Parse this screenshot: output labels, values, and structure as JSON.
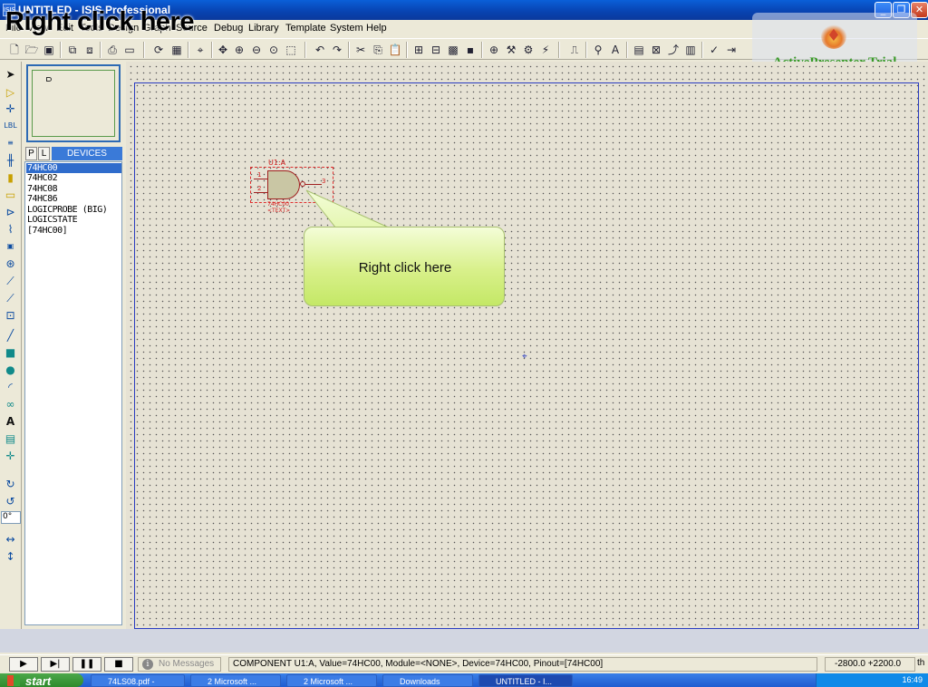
{
  "window": {
    "app_icon": "ISIS",
    "title": "UNTITLED - ISIS Professional",
    "minimize": "_",
    "maximize": "❐",
    "close": "✕"
  },
  "overlay": {
    "heading": "Right click here"
  },
  "menu": {
    "items": [
      "File",
      "View",
      "Edit",
      "Tools",
      "Design",
      "Graph",
      "Source",
      "Debug",
      "Library",
      "Template",
      "System",
      "Help"
    ]
  },
  "toolbar": {
    "icons": [
      "new-file-icon",
      "open-file-icon",
      "save-icon",
      "import-icon",
      "export-icon",
      "print-icon",
      "mark-area-icon",
      "redraw-icon",
      "grid-icon",
      "origin-icon",
      "pan-icon",
      "zoom-in-icon",
      "zoom-out-icon",
      "zoom-all-icon",
      "zoom-area-icon",
      "undo-icon",
      "redo-icon",
      "cut-icon",
      "copy-icon",
      "paste-icon",
      "block-copy-icon",
      "block-move-icon",
      "block-rotate-icon",
      "block-delete-icon",
      "pick-device-icon",
      "make-device-icon",
      "packaging-tool-icon",
      "decompose-icon",
      "wire-autorouter-icon",
      "search-tag-icon",
      "property-tool-icon",
      "new-sheet-icon",
      "remove-sheet-icon",
      "exit-to-parent-icon",
      "view-bom-icon",
      "electrical-rules-check-icon",
      "netlist-to-ares-icon"
    ]
  },
  "watermark": {
    "text": "ActivePresenter Trial"
  },
  "tools": {
    "angle": "0°"
  },
  "devices": {
    "tab_p": "P",
    "tab_l": "L",
    "header": "DEVICES",
    "items": [
      {
        "name": "74HC00",
        "selected": true
      },
      {
        "name": "74HC02",
        "selected": false
      },
      {
        "name": "74HC08",
        "selected": false
      },
      {
        "name": "74HC86",
        "selected": false
      },
      {
        "name": "LOGICPROBE (BIG)",
        "selected": false
      },
      {
        "name": "LOGICSTATE",
        "selected": false
      },
      {
        "name": "[74HC00]",
        "selected": false
      }
    ]
  },
  "component": {
    "ref": "U1:A",
    "pin1": "1",
    "pin2": "2",
    "pin3": "3",
    "value": "74HC00",
    "text": "<TEXT>"
  },
  "callout": {
    "text": "Right click here"
  },
  "status": {
    "play": "▶",
    "step": "▶|",
    "pause": "❚❚",
    "stop": "■",
    "messages": "No Messages",
    "info_icon": "i",
    "text": "COMPONENT U1:A, Value=74HC00, Module=<NONE>, Device=74HC00, Pinout=[74HC00]",
    "coords": "-2800.0   +2200.0",
    "units": "th"
  },
  "taskbar": {
    "start": "start",
    "tasks": [
      {
        "label": "74LS08.pdf -",
        "active": false
      },
      {
        "label": "2 Microsoft ...",
        "active": false
      },
      {
        "label": "2 Microsoft ...",
        "active": false
      },
      {
        "label": "Downloads",
        "active": false
      },
      {
        "label": "UNTITLED - I...",
        "active": true
      }
    ],
    "clock": "16:49"
  }
}
